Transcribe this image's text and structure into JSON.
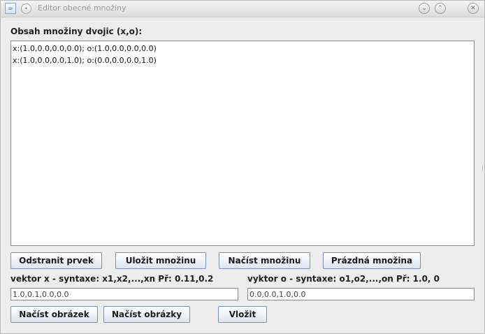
{
  "window": {
    "title": "Editor obecné množiny",
    "icons": {
      "app": "java-cup-icon",
      "menu": "window-menu-icon",
      "minimize": "chevron-down-icon",
      "maximize": "chevron-up-icon",
      "close": "close-icon"
    }
  },
  "set_panel": {
    "label": "Obsah množiny dvojic (x,o):",
    "items": [
      "x:(1.0,0.0,0.0,0.0); o:(1.0,0.0,0.0,0.0)",
      "x:(1.0,0.0,0.0,1.0); o:(0.0,0.0,0.0,1.0)"
    ]
  },
  "actions": {
    "remove_item": "Odstranit prvek",
    "save_set": "Uložit množinu",
    "load_set": "Načíst množinu",
    "empty_set": "Prázdná množina"
  },
  "vector_x": {
    "label": "vektor x - syntaxe: x1,x2,...,xn Př: 0.11,0.2",
    "value": "1.0,0.1,0.0,0.0"
  },
  "vector_o": {
    "label": "vyktor o - syntaxe: o1,o2,...,on Př: 1.0, 0",
    "value": "0.0,0.0,1.0,0.0"
  },
  "bottom_actions": {
    "load_image": "Načíst obrázek",
    "load_images": "Načíst obrázky",
    "insert": "Vložit"
  }
}
